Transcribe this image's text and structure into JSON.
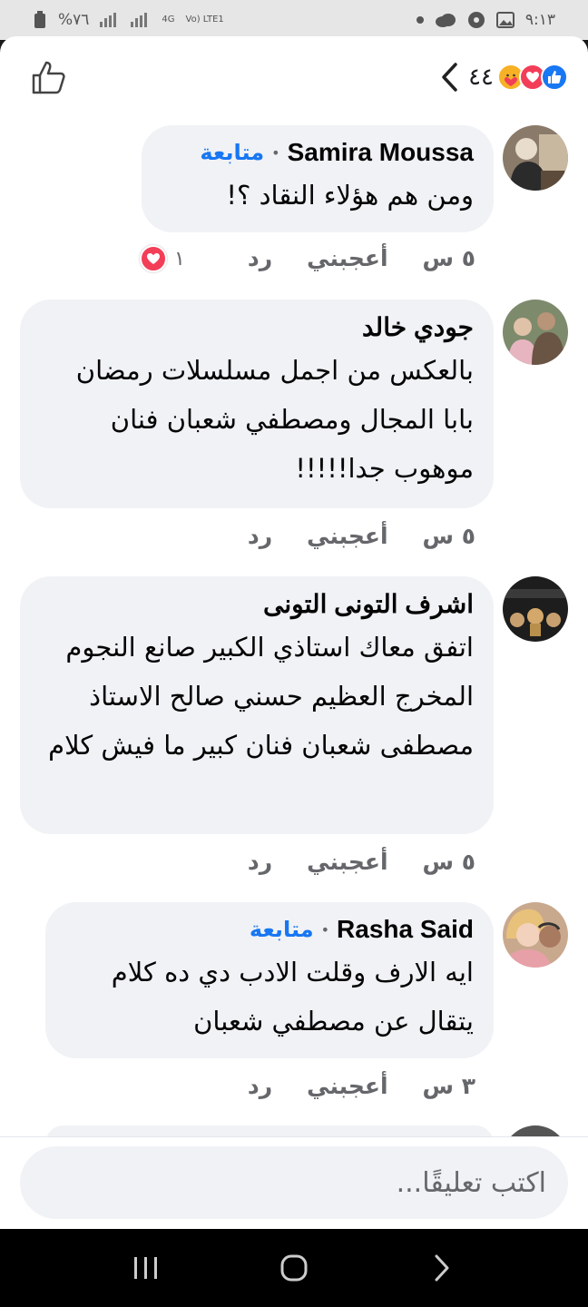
{
  "status_bar": {
    "time": "٩:١٣",
    "battery": "%٧٦",
    "network_4g": "4G",
    "volte": "Vo) LTE1"
  },
  "header": {
    "reaction_count": "٤٤",
    "reaction_icons": [
      "like-icon",
      "love-icon",
      "care-icon"
    ]
  },
  "comments": [
    {
      "author": "Samira Moussa",
      "follow": "متابعة",
      "text": "ومن هم هؤلاء النقاد ؟!",
      "time": "٥ س",
      "like_label": "أعجبني",
      "reply_label": "رد",
      "reaction_count": "١"
    },
    {
      "author": "جودي خالد",
      "text": "بالعكس من اجمل مسلسلات رمضان بابا المجال ومصطفي شعبان فنان موهوب جدا!!!!!",
      "time": "٥ س",
      "like_label": "أعجبني",
      "reply_label": "رد"
    },
    {
      "author": "اشرف التونى التونى",
      "text": "اتفق معاك استاذي الكبير صانع النجوم المخرج العظيم حسني صالح الاستاذ مصطفى شعبان فنان كبير ما فيش كلام",
      "time": "٥ س",
      "like_label": "أعجبني",
      "reply_label": "رد"
    },
    {
      "author": "Rasha Said",
      "follow": "متابعة",
      "text": "ايه الارف وقلت الادب دي ده كلام يتقال عن مصطفي شعبان",
      "time": "٣ س",
      "like_label": "أعجبني",
      "reply_label": "رد"
    }
  ],
  "input": {
    "placeholder": "اكتب تعليقًا..."
  },
  "colors": {
    "accent": "#1877f2",
    "bubble": "#f0f2f5",
    "love": "#f33e58"
  }
}
